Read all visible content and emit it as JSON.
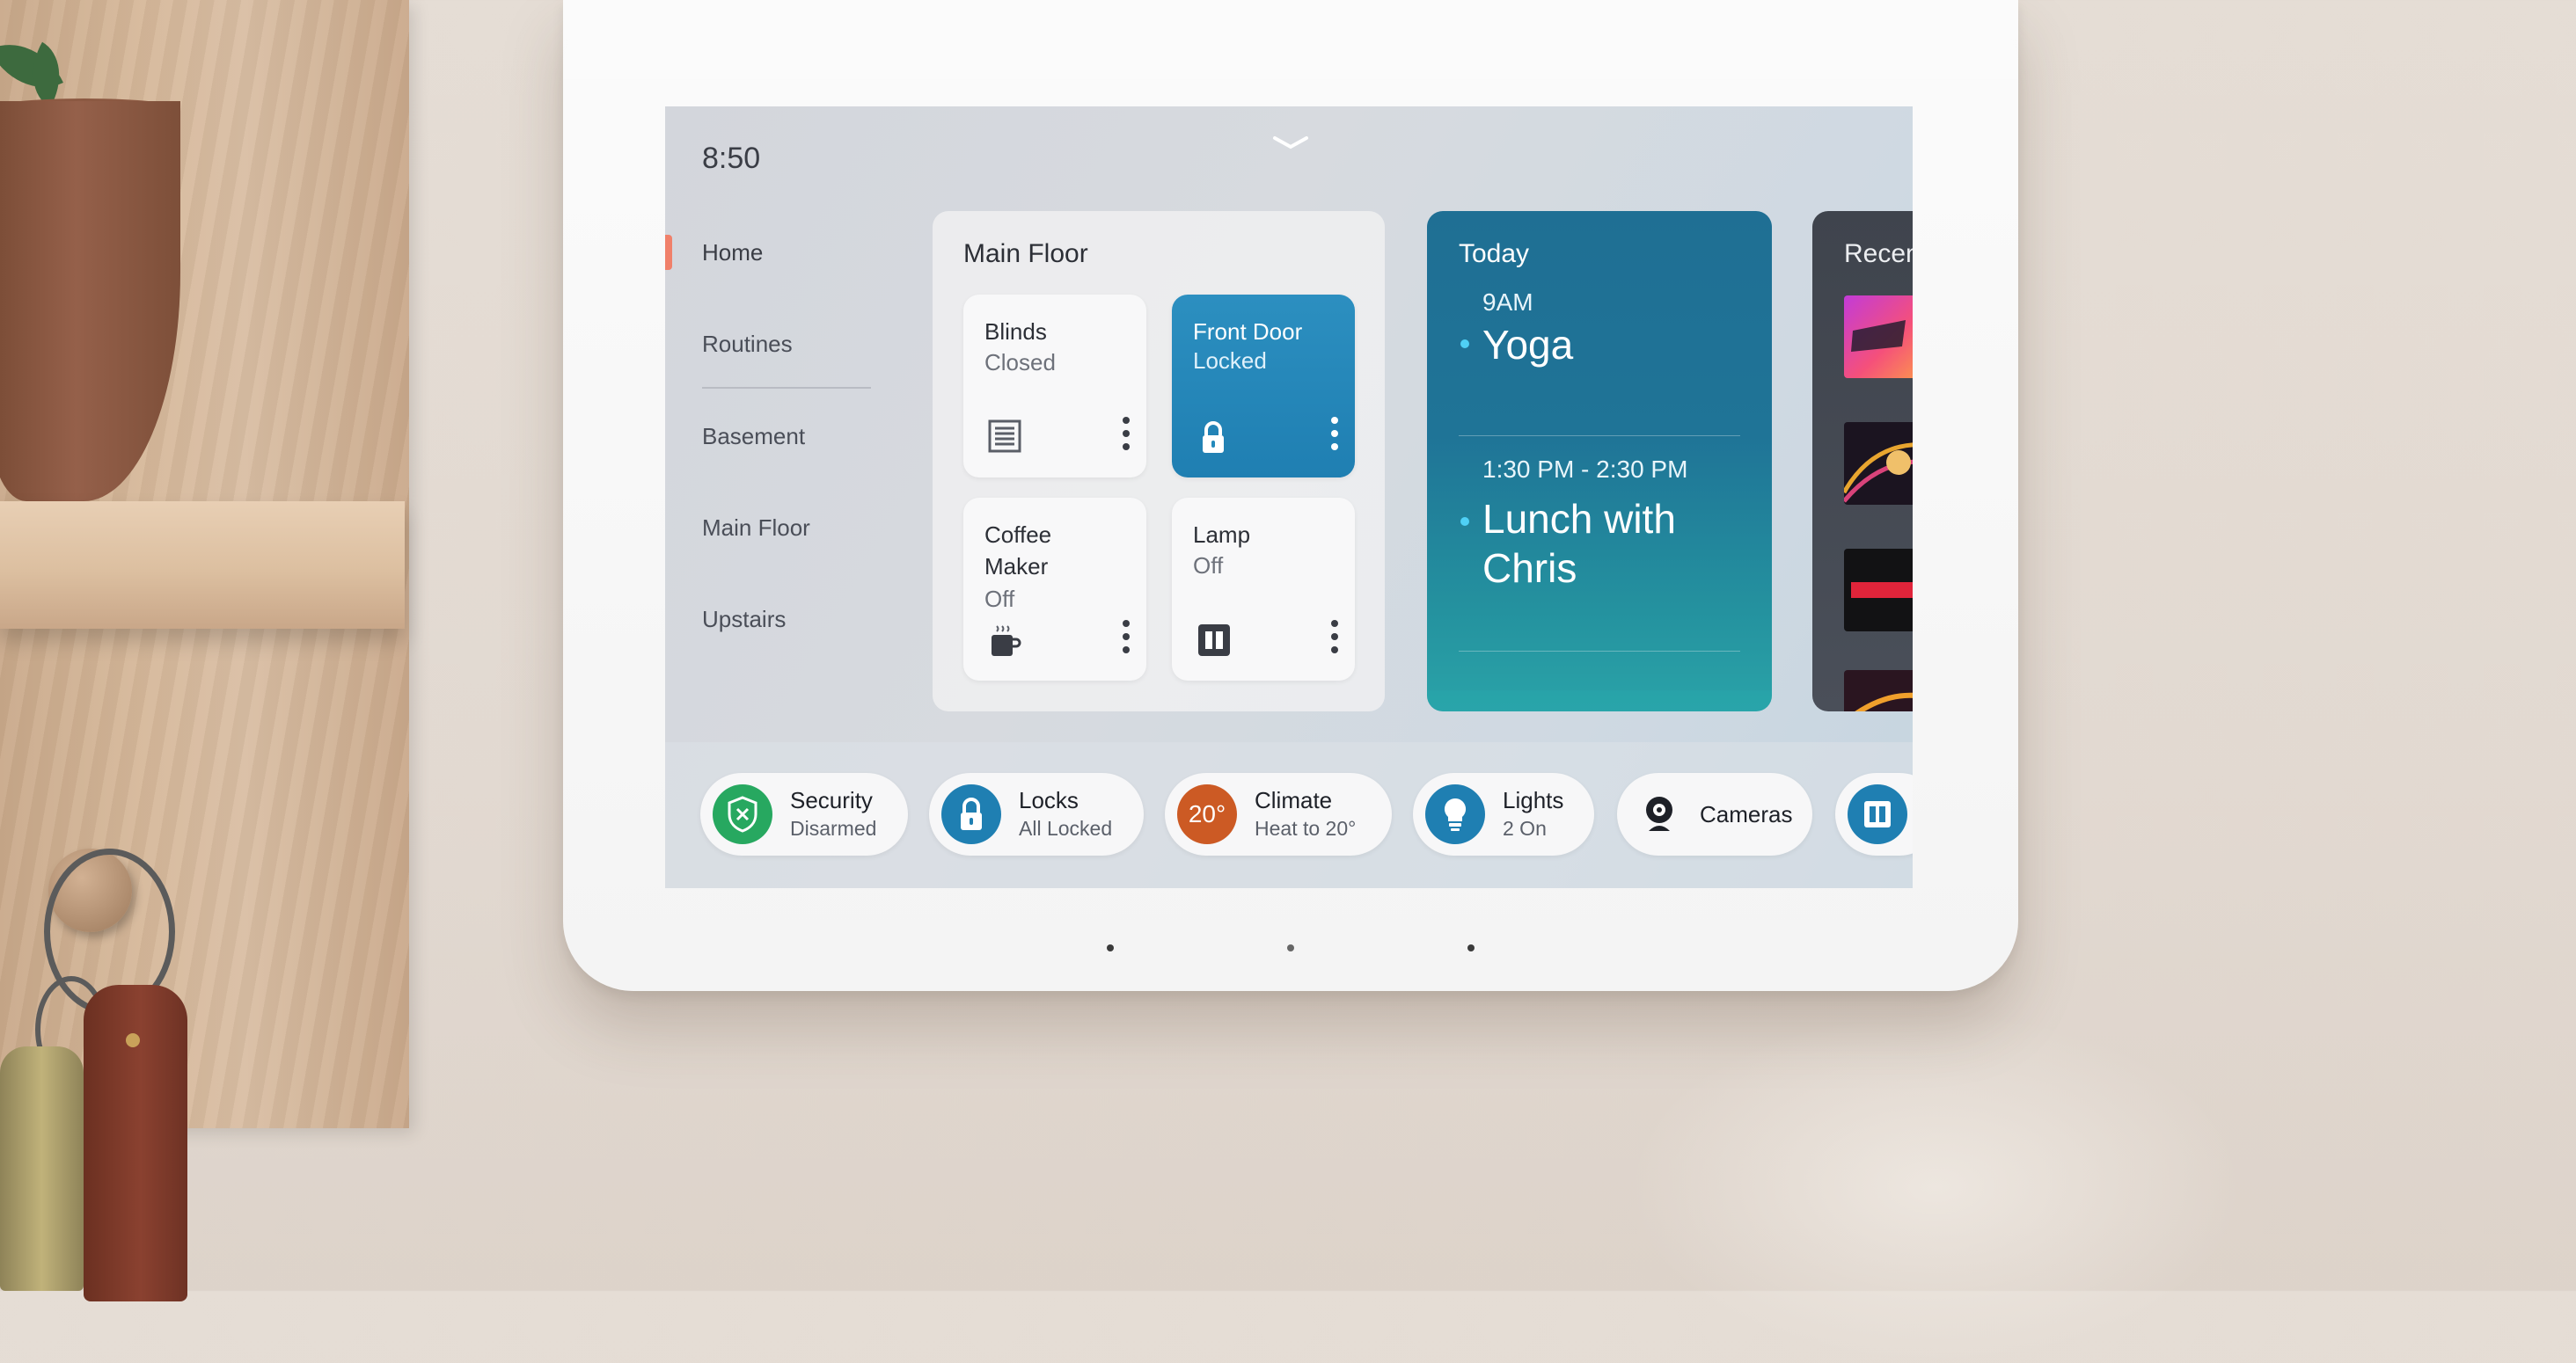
{
  "status": {
    "time": "8:50"
  },
  "nav": {
    "items": [
      {
        "label": "Home"
      },
      {
        "label": "Routines"
      },
      {
        "label": "Basement"
      },
      {
        "label": "Main Floor"
      },
      {
        "label": "Upstairs"
      }
    ]
  },
  "main_floor": {
    "title": "Main Floor",
    "tiles": [
      {
        "name": "Blinds",
        "status": "Closed",
        "icon": "blinds-icon"
      },
      {
        "name": "Front Door",
        "status": "Locked",
        "icon": "lock-icon"
      },
      {
        "name": "Coffee Maker",
        "status": "Off",
        "icon": "coffee-maker-icon"
      },
      {
        "name": "Lamp",
        "status": "Off",
        "icon": "lamp-icon"
      }
    ]
  },
  "today": {
    "title": "Today",
    "events": [
      {
        "time": "9AM",
        "title": "Yoga"
      },
      {
        "time": "1:30 PM - 2:30 PM",
        "title": "Lunch with Chris"
      }
    ]
  },
  "recent": {
    "title": "Recent"
  },
  "quick_controls": [
    {
      "title": "Security",
      "subtitle": "Disarmed",
      "icon": "shield-icon",
      "color": "#27a860"
    },
    {
      "title": "Locks",
      "subtitle": "All Locked",
      "icon": "lock-icon",
      "color": "#1f7fb2"
    },
    {
      "title": "Climate",
      "subtitle": "Heat to 20°",
      "icon_text": "20°",
      "color": "#cc5a24"
    },
    {
      "title": "Lights",
      "subtitle": "2 On",
      "icon": "bulb-icon",
      "color": "#1f7fb2"
    },
    {
      "title": "Cameras",
      "icon": "camera-icon",
      "color": "#1e2128"
    }
  ],
  "colors": {
    "accent_nav": "#f0806a",
    "front_door_tile": "#2389bb",
    "calendar_card": "#1f7497"
  }
}
